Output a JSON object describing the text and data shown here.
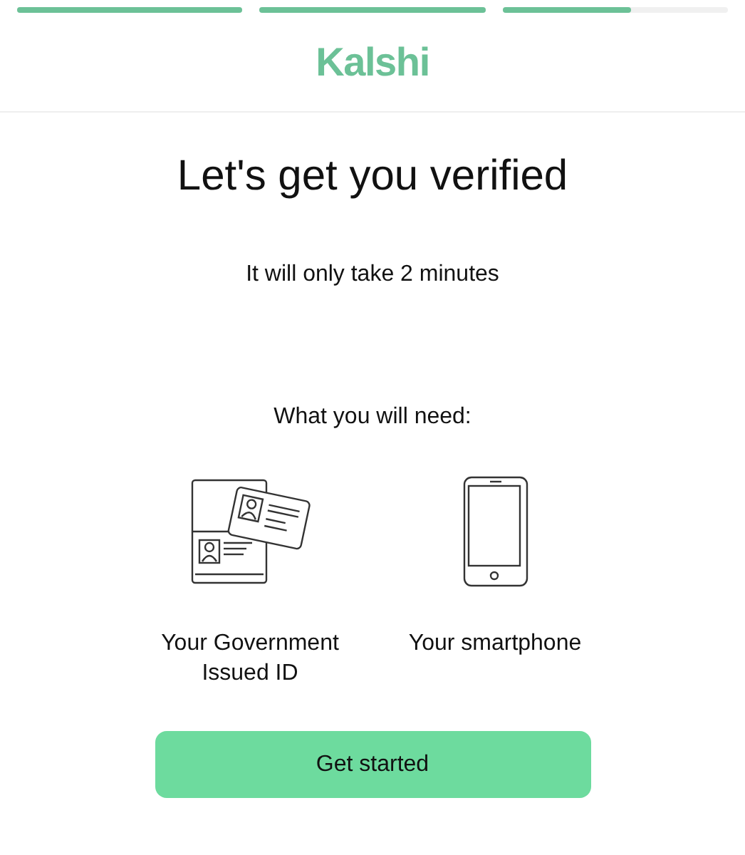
{
  "progress": [
    {
      "level": 1
    },
    {
      "level": 1
    },
    {
      "level": 0.57
    }
  ],
  "logo": "Kalshi",
  "title": "Let's get you verified",
  "subtitle": "It will only take 2 minutes",
  "needs_heading": "What you will need:",
  "needs": [
    {
      "kind": "id",
      "label": "Your Government Issued ID"
    },
    {
      "kind": "phone",
      "label": "Your smartphone"
    }
  ],
  "button": "Get started"
}
